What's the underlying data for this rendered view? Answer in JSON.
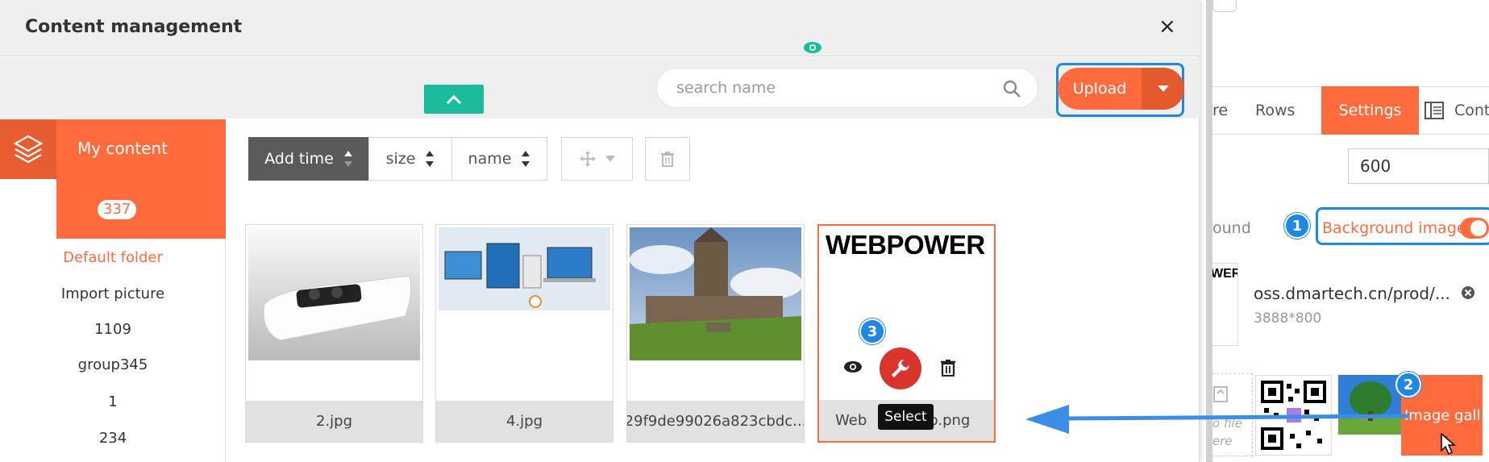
{
  "modal": {
    "title": "Content management",
    "close_symbol": "×",
    "search": {
      "placeholder": "search name"
    },
    "upload": {
      "label": "Upload"
    }
  },
  "sidebar": {
    "my_content": {
      "label": "My content",
      "count": "337"
    },
    "folders": [
      "Default folder",
      "Import picture",
      "1109",
      "group345",
      "1",
      "234"
    ]
  },
  "sort_bar": {
    "add_time": "Add time",
    "size": "size",
    "name": "name"
  },
  "files": [
    {
      "name": "2.jpg"
    },
    {
      "name": "4.jpg"
    },
    {
      "name": "29f9de99026a823cbdc..."
    },
    {
      "name": "Web",
      "name_tail": "go.png",
      "logo_text": "WEBPOWER"
    }
  ],
  "hover": {
    "tooltip": "Select",
    "step_badge": "3"
  },
  "right_panel": {
    "tabs": [
      "re",
      "Rows",
      "Settings",
      "Conte"
    ],
    "width_value": "600",
    "bound_label": "ound",
    "background_image_label": "Background image",
    "background_image_toggle": true,
    "file_url": "oss.dmartech.cn/prod/...",
    "file_dims": "3888*800",
    "thumb_text": "WER",
    "drop_hint_line1": "o file",
    "drop_hint_line2": "ere",
    "gallery_label": "Image gall",
    "badges": [
      "1",
      "2"
    ]
  },
  "colors": {
    "accent": "#ff6b3d",
    "accent_dark": "#e35a2c",
    "highlight_blue": "#1e88e5",
    "teal": "#1abc9c",
    "select_red": "#d9342b"
  }
}
